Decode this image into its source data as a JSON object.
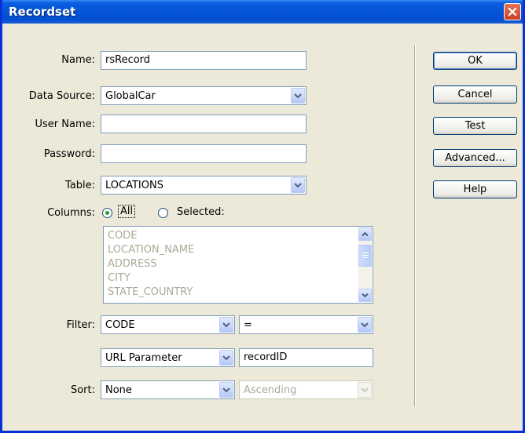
{
  "window": {
    "title": "Recordset"
  },
  "form": {
    "name_label": "Name:",
    "name_value": "rsRecord",
    "datasource_label": "Data Source:",
    "datasource_value": "GlobalCar",
    "username_label": "User Name:",
    "username_value": "",
    "password_label": "Password:",
    "password_value": "",
    "table_label": "Table:",
    "table_value": "LOCATIONS",
    "columns_label": "Columns:",
    "columns_all": "All",
    "columns_selected": "Selected:",
    "columns_list": [
      "CODE",
      "LOCATION_NAME",
      "ADDRESS",
      "CITY",
      "STATE_COUNTRY"
    ],
    "filter_label": "Filter:",
    "filter_column": "CODE",
    "filter_operator": "=",
    "filter_source": "URL Parameter",
    "filter_value": "recordID",
    "sort_label": "Sort:",
    "sort_column": "None",
    "sort_order": "Ascending"
  },
  "buttons": {
    "ok": "OK",
    "cancel": "Cancel",
    "test": "Test",
    "advanced": "Advanced...",
    "help": "Help"
  },
  "colors": {
    "title_bar": "#0553d6",
    "dialog_bg": "#ece9d8",
    "radio_selected": "#2d9a2d"
  }
}
